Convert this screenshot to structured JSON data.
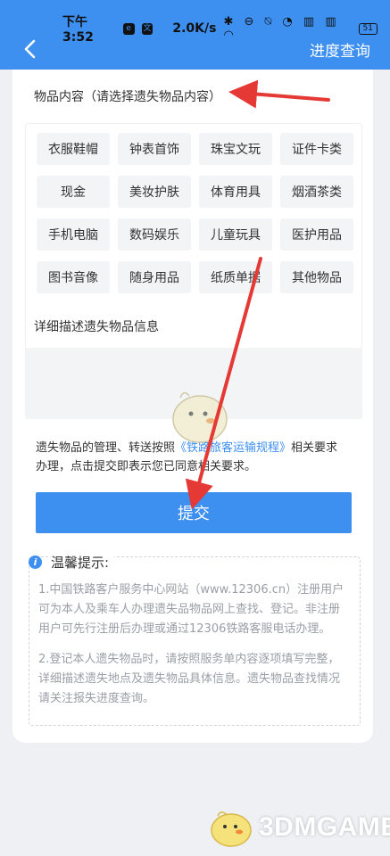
{
  "status_bar": {
    "time": "下午3:52",
    "speed": "2.0K/s",
    "icons": "✱ ⊖ ⍉ ◔ ▥ ▥ ◠",
    "battery": "51"
  },
  "header": {
    "title": "进度查询",
    "back_icon": "chevron-left-icon"
  },
  "form": {
    "category_label": "物品内容（请选择遗失物品内容）",
    "categories": [
      "衣服鞋帽",
      "钟表首饰",
      "珠宝文玩",
      "证件卡类",
      "现金",
      "美妆护肤",
      "体育用具",
      "烟酒茶类",
      "手机电脑",
      "数码娱乐",
      "儿童玩具",
      "医护用品",
      "图书音像",
      "随身用品",
      "纸质单据",
      "其他物品"
    ],
    "description_label": "详细描述遗失物品信息",
    "description_value": "",
    "notice_prefix": "遗失物品的管理、转送按照",
    "notice_link": "《铁路旅客运输规程》",
    "notice_suffix": "相关要求办理，点击提交即表示您已同意相关要求。",
    "submit_label": "提交"
  },
  "tips": {
    "title": "温馨提示:",
    "items": [
      "1.中国铁路客户服务中心网站（www.12306.cn）注册用户可为本人及乘车人办理遗失品物品网上查找、登记。非注册用户可先行注册后办理或通过12306铁路客服电话办理。",
      "2.登记本人遗失物品时，请按照服务单内容逐项填写完整，详细描述遗失地点及遗失物品具体信息。遗失物品查找情况请关注报失进度查询。"
    ]
  },
  "annotations": {
    "arrow_color": "#e53935"
  },
  "watermark": {
    "text": "3DMGAME"
  }
}
